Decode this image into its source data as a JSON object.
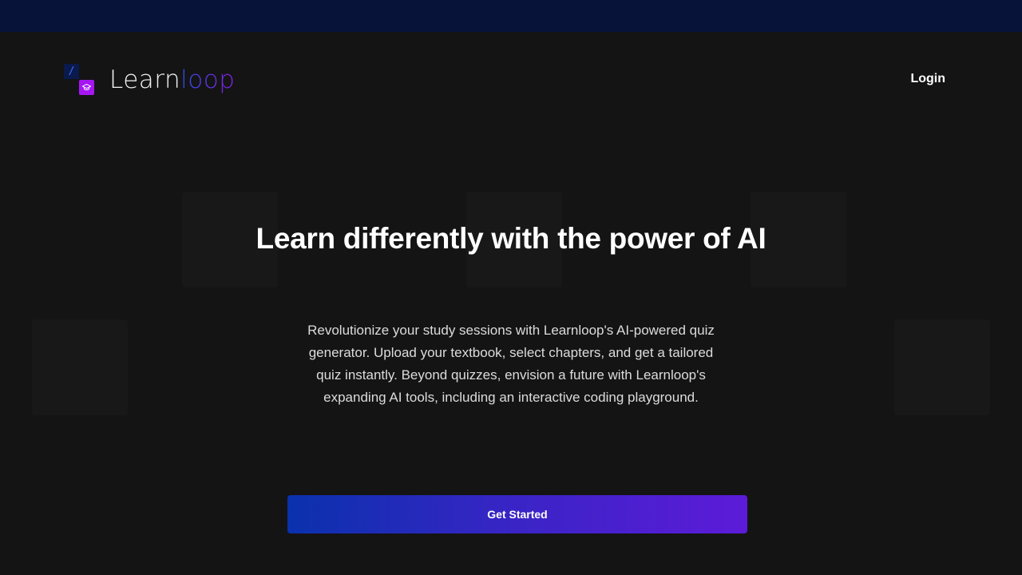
{
  "header": {
    "logo": {
      "code_glyph": "/",
      "text_part1": "Learn",
      "text_part2": "loop",
      "icon": "graduation-cap-icon",
      "colors": {
        "code_bg": "#0b1a4d",
        "code_glyph": "#3a6cff",
        "cap_bg": "#a516f2",
        "gradient_start": "#2f4de6",
        "gradient_end": "#8a1ee6"
      }
    },
    "login_label": "Login"
  },
  "hero": {
    "title": "Learn differently with the power of AI",
    "description": "Revolutionize your study sessions with Learnloop's AI-powered quiz generator. Upload your textbook, select chapters, and get a tailored quiz instantly. Beyond quizzes, envision a future with Learnloop's expanding AI tools, including an interactive coding playground.",
    "cta_label": "Get Started"
  },
  "colors": {
    "page_bg": "#141414",
    "top_band": "#071338",
    "cta_gradient_start": "#0a31ad",
    "cta_gradient_end": "#5d1bd8"
  }
}
